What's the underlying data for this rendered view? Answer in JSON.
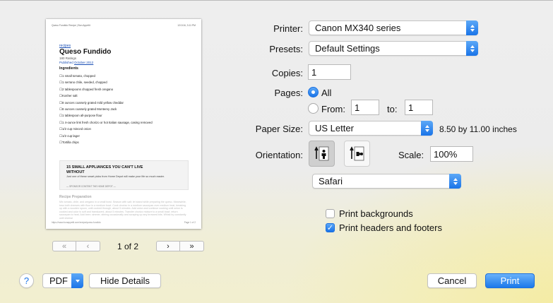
{
  "preview": {
    "header_left": "Queso Fundido Recipe | Bon Appétit",
    "header_right": "12/1/16, 3:11 PM",
    "category": "recipes",
    "title": "Queso Fundido",
    "ratings": "180 Ratings",
    "published_prefix": "Published ",
    "published_date": "October 2012",
    "ingredients_heading": "Ingredients",
    "ingredients": [
      "1 small tomato, chopped",
      "1 serrano chile, seeded, chopped",
      "2 tablespoons chopped fresh oregano",
      "Kosher salt",
      "8 ounces coarsely grated mild yellow cheddar",
      "8 ounces coarsely grated Monterey Jack",
      "1 tablespoon all-purpose flour",
      "1 4-ounce link fresh chorizo or hot Italian sausage, casing removed",
      "1/2 cup minced onion",
      "1/2 cup lager",
      "Tortilla chips"
    ],
    "ad_title": "15 SMALL APPLIANCES YOU CAN'T LIVE WITHOUT",
    "ad_body": "Just one of these smart picks from Home Depot will make your life so much easier.",
    "ad_sponsor": "— SPONSOR CONTENT THE HOME DEPOT —",
    "prep_heading": "Recipe Preparation",
    "prep_text": "Mix tomato, chile, and oregano in a small bowl. Season with salt; let stand while preparing the queso. Meanwhile, toss both cheeses with flour in a medium bowl. Cook chorizo in a medium saucepan over medium heat, breaking up with a wooden spoon, until cooked through, about 5 minutes. Add onion and continue cooking until onion is cooked and color is soft and translucent, about 5 minutes. Transfer chorizo mixture to a small bowl; return saucepan to heat. Add beer; simmer, stirring occasionally and scraping up any browned bits. Whisk by constantly until cheese",
    "footer_left": "https://www.bonappetit.com/recipe/queso-fundido",
    "footer_right": "Page 1 of 2"
  },
  "nav": {
    "first": "«",
    "prev": "‹",
    "next": "›",
    "last": "»",
    "page_current": 1,
    "page_total": 2,
    "page_label": "1 of 2"
  },
  "form": {
    "printer_label": "Printer:",
    "printer_value": "Canon MX340 series",
    "presets_label": "Presets:",
    "presets_value": "Default Settings",
    "copies_label": "Copies:",
    "copies_value": "1",
    "pages_label": "Pages:",
    "pages_all": "All",
    "pages_from": "From:",
    "pages_from_value": "1",
    "pages_to": "to:",
    "pages_to_value": "1",
    "paper_label": "Paper Size:",
    "paper_value": "US Letter",
    "paper_dims": "8.50 by 11.00 inches",
    "orientation_label": "Orientation:",
    "scale_label": "Scale:",
    "scale_value": "100%",
    "section_value": "Safari",
    "print_backgrounds": "Print backgrounds",
    "print_backgrounds_checked": false,
    "print_headers": "Print headers and footers",
    "print_headers_checked": true
  },
  "footer": {
    "help": "?",
    "pdf": "PDF",
    "hide_details": "Hide Details",
    "cancel": "Cancel",
    "print": "Print"
  },
  "colors": {
    "accent": "#1a74e8",
    "link": "#1a4fb5"
  }
}
